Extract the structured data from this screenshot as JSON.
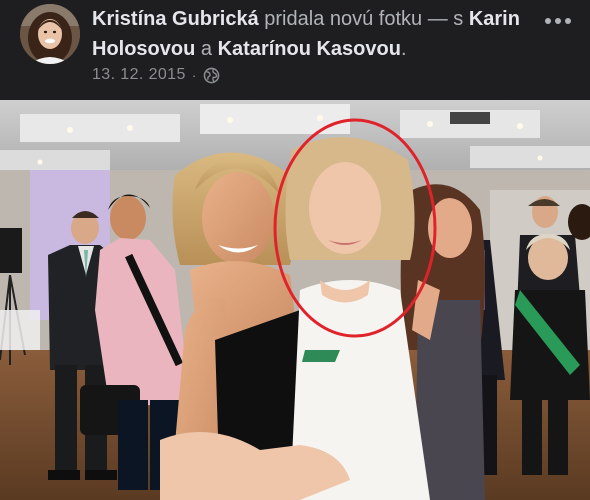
{
  "post": {
    "author": "Kristína Gubrická",
    "action_text": " pridala novú fotku — s ",
    "tagged_1": "Karin Holosovou",
    "conjunction": " a ",
    "tagged_2": "Katarínou Kasovou",
    "end_punct": ".",
    "date": "13. 12. 2015",
    "separator": "·",
    "audience_icon": "globe-icon",
    "menu_icon": "more-options-icon"
  },
  "photo": {
    "highlight_color": "#e0232a",
    "highlight_shape": "ellipse"
  }
}
